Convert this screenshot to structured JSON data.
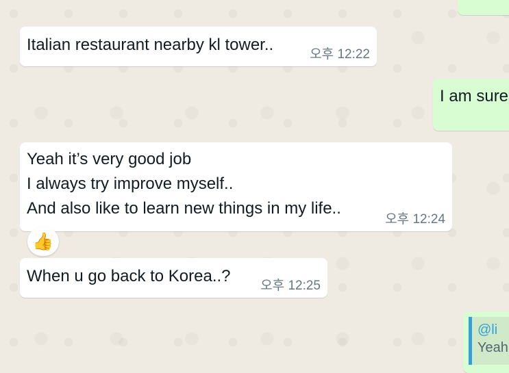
{
  "messages": [
    {
      "id": "m1",
      "direction": "incoming",
      "lines": [
        "Italian restaurant nearby kl tower.."
      ],
      "time": "오후 12:22"
    },
    {
      "id": "m2",
      "direction": "outgoing",
      "lines": [
        "I am sure"
      ]
    },
    {
      "id": "m3",
      "direction": "incoming",
      "lines": [
        "Yeah it’s very good job",
        "I always try improve myself..",
        "And also like to learn new things in my life.."
      ],
      "time": "오후 12:24",
      "reaction": "👍"
    },
    {
      "id": "m4",
      "direction": "incoming",
      "lines": [
        "When u go back to Korea..?"
      ],
      "time": "오후 12:25"
    },
    {
      "id": "m5",
      "direction": "outgoing",
      "quoted_author": "@li",
      "quoted_text": "Yeah"
    }
  ],
  "colors": {
    "incoming_bubble": "#ffffff",
    "outgoing_bubble": "#d9fdd3",
    "quote_accent": "#35a0d8",
    "time_text": "#667781",
    "wallpaper": "#efeae2"
  }
}
